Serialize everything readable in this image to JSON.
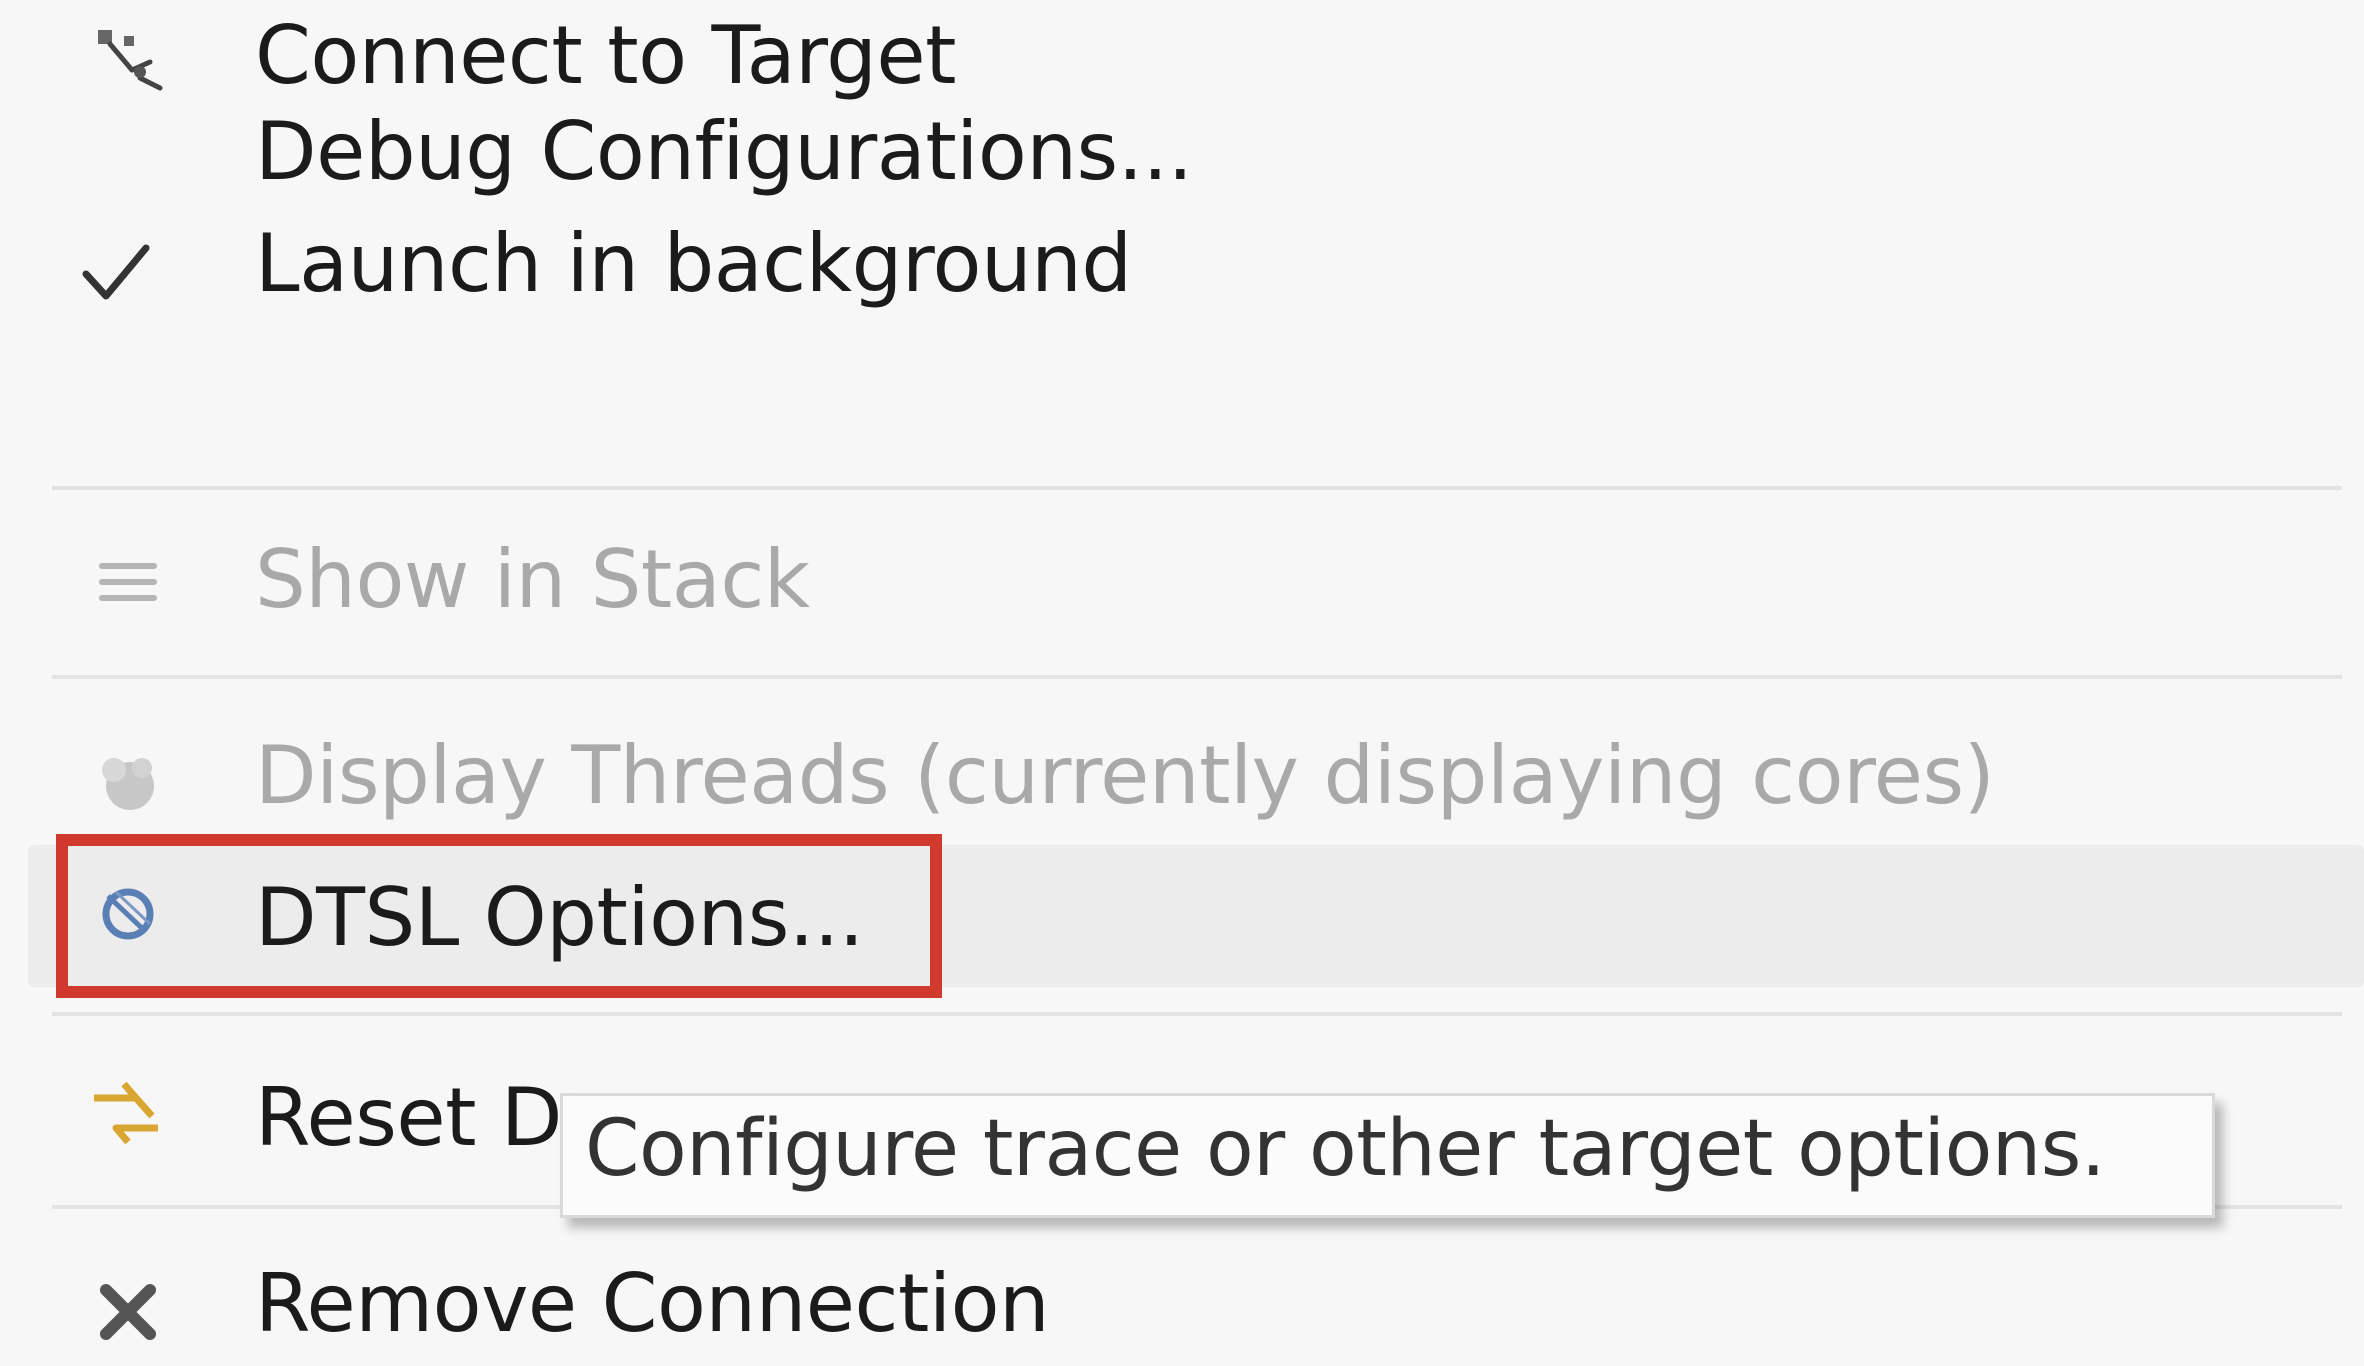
{
  "menu": {
    "items": [
      {
        "label": "Connect to Target",
        "icon": "connect-target-icon",
        "enabled": true
      },
      {
        "label": "Debug Configurations...",
        "icon": "",
        "enabled": true
      },
      {
        "label": "Launch in background",
        "icon": "checkmark-icon",
        "enabled": true,
        "checked": true
      },
      {
        "label": "Show in Stack",
        "icon": "stack-list-icon",
        "enabled": false
      },
      {
        "label": "Display Threads (currently displaying cores)",
        "icon": "threads-icon",
        "enabled": false
      },
      {
        "label": "DTSL Options...",
        "icon": "dtsl-options-icon",
        "enabled": true,
        "hovered": true
      },
      {
        "label": "Reset D",
        "icon": "reset-swap-icon",
        "enabled": true
      },
      {
        "label": "Remove Connection",
        "icon": "remove-x-icon",
        "enabled": true
      }
    ]
  },
  "tooltip": {
    "text": "Configure trace or other target options."
  },
  "colors": {
    "highlight": "#d0392b",
    "menu_bg": "#f7f7f7",
    "disabled_text": "#a9a9a9"
  }
}
